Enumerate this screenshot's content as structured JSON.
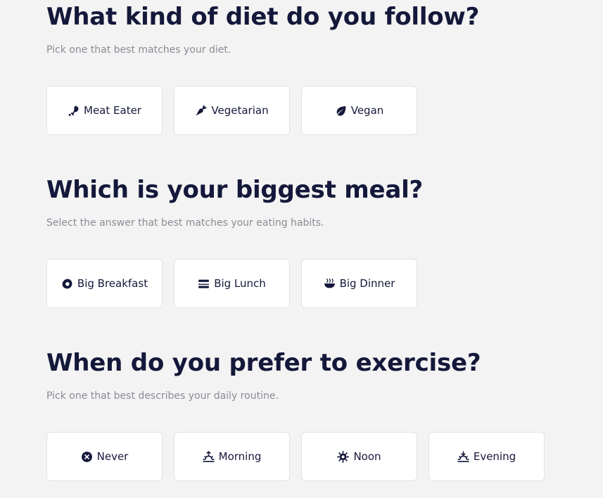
{
  "accent_color": "#14183a",
  "background_color": "#f3f3f3",
  "sections": [
    {
      "title": "What kind of diet do you follow?",
      "subtitle": "Pick one that best matches your diet.",
      "options": [
        {
          "label": "Meat Eater",
          "icon": "drumstick-icon"
        },
        {
          "label": "Vegetarian",
          "icon": "carrot-icon"
        },
        {
          "label": "Vegan",
          "icon": "leaf-icon"
        }
      ]
    },
    {
      "title": "Which is your biggest meal?",
      "subtitle": "Select the answer that best matches your eating habits.",
      "options": [
        {
          "label": "Big Breakfast",
          "icon": "egg-icon"
        },
        {
          "label": "Big Lunch",
          "icon": "sandwich-icon"
        },
        {
          "label": "Big Dinner",
          "icon": "bowl-icon"
        }
      ]
    },
    {
      "title": "When do you prefer to exercise?",
      "subtitle": "Pick one that best describes your daily routine.",
      "options": [
        {
          "label": "Never",
          "icon": "x-circle-icon"
        },
        {
          "label": "Morning",
          "icon": "sunrise-icon"
        },
        {
          "label": "Noon",
          "icon": "sun-icon"
        },
        {
          "label": "Evening",
          "icon": "sunset-icon"
        }
      ]
    }
  ]
}
